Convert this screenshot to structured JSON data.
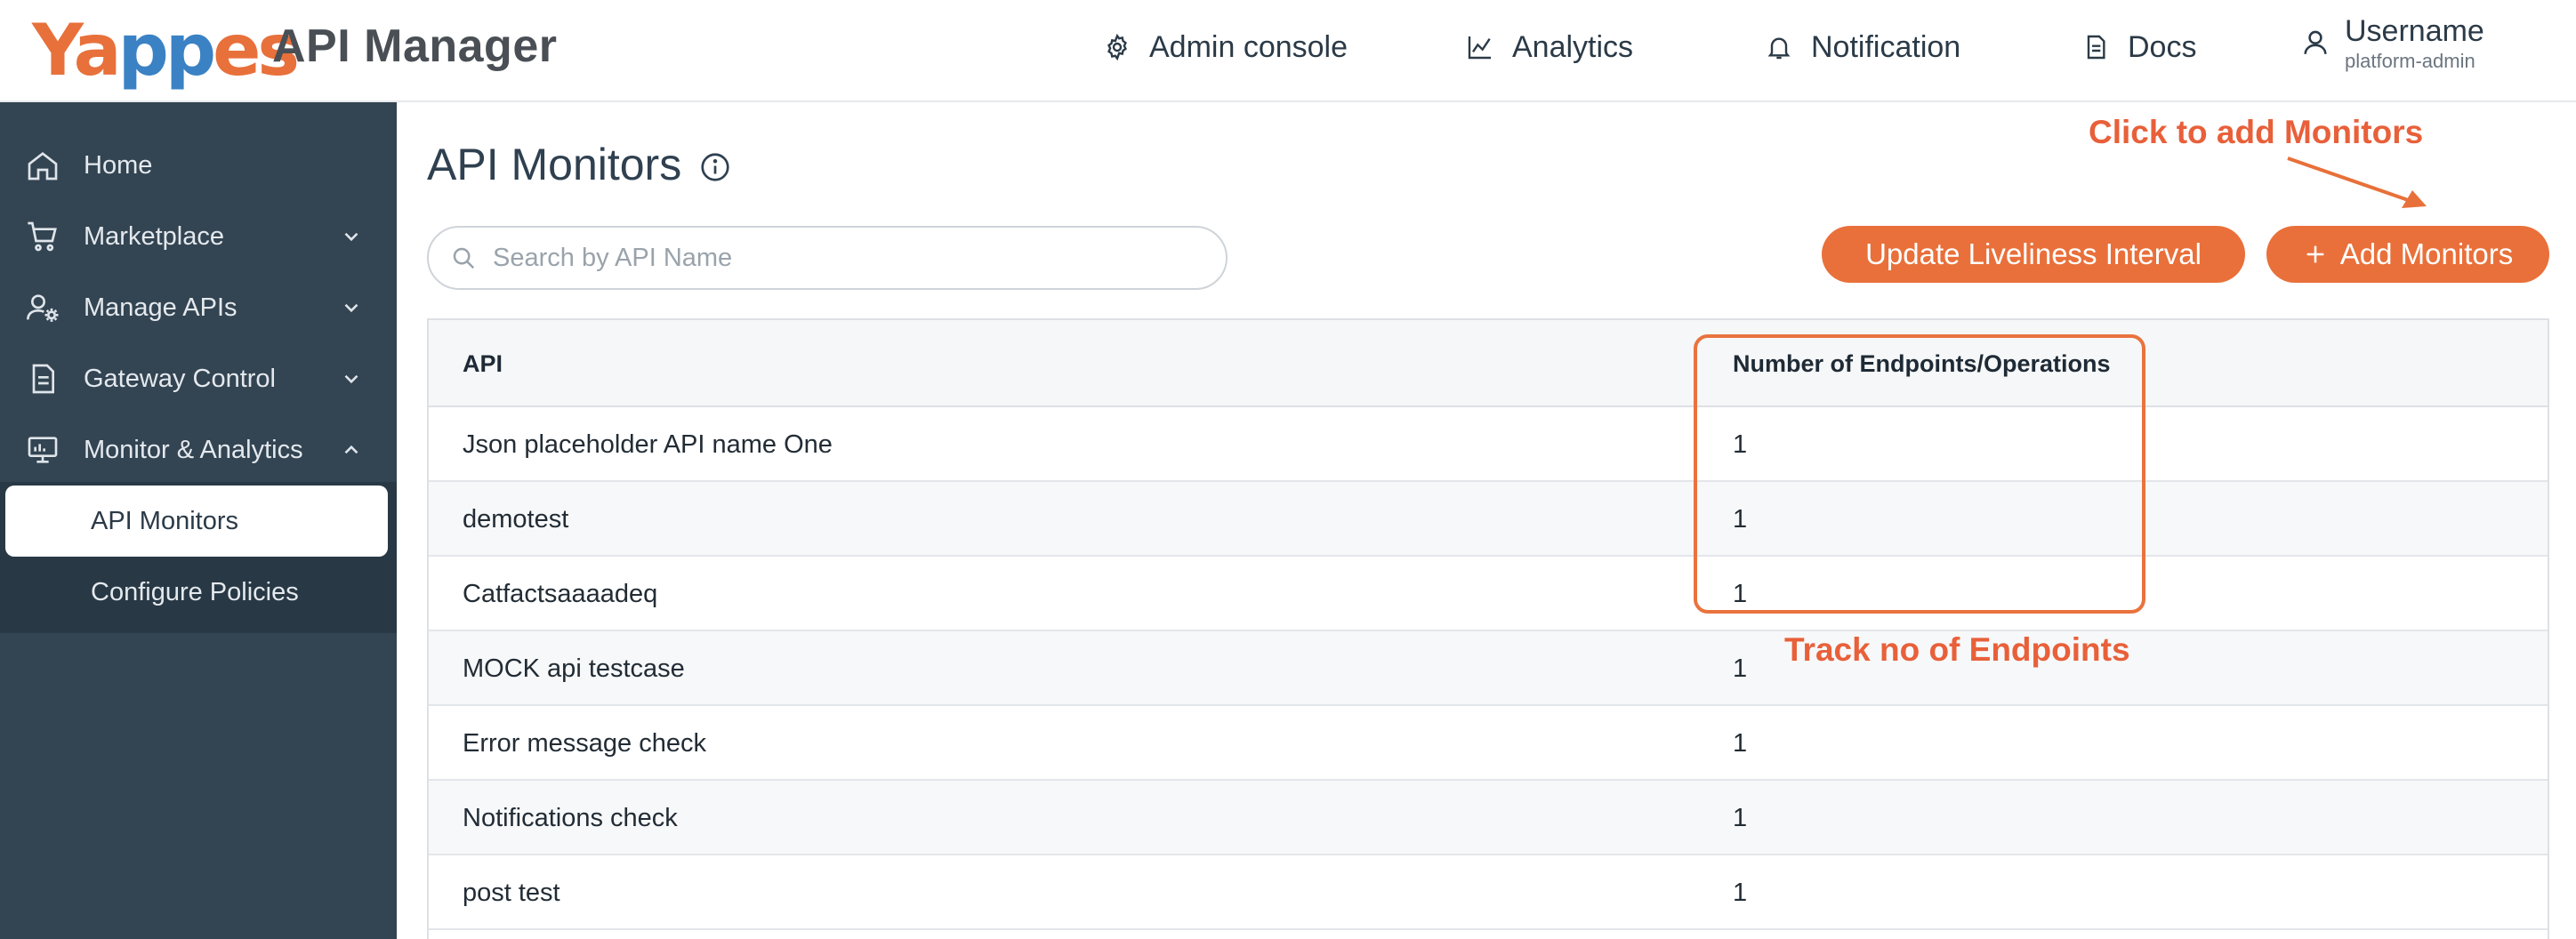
{
  "header": {
    "logo_text": "Yappes",
    "app_name": "API Manager",
    "nav": [
      {
        "label": "Admin console",
        "icon": "gear-icon"
      },
      {
        "label": "Analytics",
        "icon": "line-chart-icon"
      },
      {
        "label": "Notification",
        "icon": "bell-icon"
      },
      {
        "label": "Docs",
        "icon": "document-icon"
      }
    ],
    "user": {
      "name": "Username",
      "role": "platform-admin",
      "icon": "user-icon"
    }
  },
  "sidebar": {
    "items": [
      {
        "label": "Home",
        "icon": "home-icon"
      },
      {
        "label": "Marketplace",
        "icon": "cart-icon",
        "expanded": false
      },
      {
        "label": "Manage APIs",
        "icon": "user-gear-icon",
        "expanded": false
      },
      {
        "label": "Gateway Control",
        "icon": "document-icon",
        "expanded": false
      },
      {
        "label": "Monitor & Analytics",
        "icon": "monitor-icon",
        "expanded": true
      }
    ],
    "subitems": [
      {
        "label": "API Monitors",
        "active": true
      },
      {
        "label": "Configure Policies",
        "active": false
      }
    ]
  },
  "main": {
    "title": "API Monitors",
    "search": {
      "placeholder": "Search by API Name",
      "value": ""
    },
    "buttons": {
      "update": "Update Liveliness Interval",
      "add": "Add Monitors"
    },
    "annotations": {
      "add_hint": "Click to add Monitors",
      "endpoints_hint": "Track no of Endpoints"
    },
    "table": {
      "columns": [
        "API",
        "Number of Endpoints/Operations"
      ],
      "rows": [
        {
          "api": "Json placeholder API name One",
          "count": "1"
        },
        {
          "api": "demotest",
          "count": "1"
        },
        {
          "api": "Catfactsaaaadeq",
          "count": "1"
        },
        {
          "api": "MOCK api testcase",
          "count": "1"
        },
        {
          "api": "Error message check",
          "count": "1"
        },
        {
          "api": "Notifications check",
          "count": "1"
        },
        {
          "api": "post test",
          "count": "1"
        }
      ]
    }
  },
  "colors": {
    "accent": "#e9703a",
    "sidebar": "#334452",
    "sidebar_sub": "#283845",
    "annotation": "#e8603a"
  }
}
